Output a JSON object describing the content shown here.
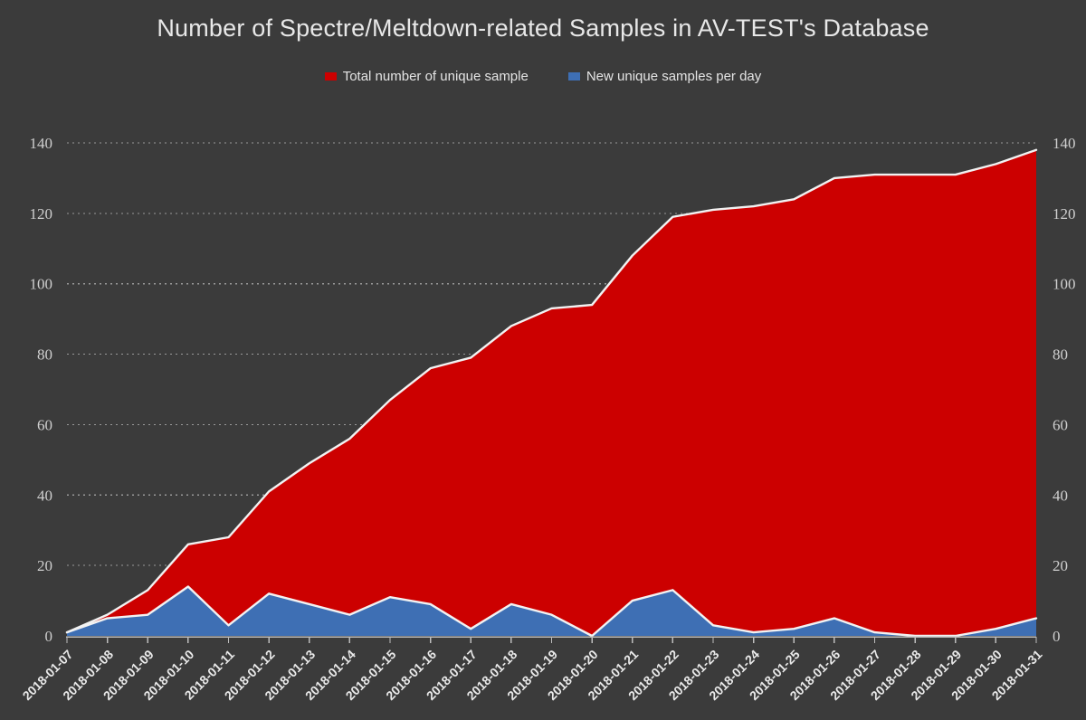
{
  "chart_data": {
    "type": "area",
    "title": "Number of Spectre/Meltdown-related Samples in AV-TEST's Database",
    "xlabel": "",
    "ylabel": "",
    "ylim": [
      0,
      140
    ],
    "yticks": [
      0,
      20,
      40,
      60,
      80,
      100,
      120,
      140
    ],
    "grid": true,
    "legend_position": "top-center",
    "dual_axis": true,
    "background_color": "#3b3b3b",
    "categories": [
      "2018-01-07",
      "2018-01-08",
      "2018-01-09",
      "2018-01-10",
      "2018-01-11",
      "2018-01-12",
      "2018-01-13",
      "2018-01-14",
      "2018-01-15",
      "2018-01-16",
      "2018-01-17",
      "2018-01-18",
      "2018-01-19",
      "2018-01-20",
      "2018-01-21",
      "2018-01-22",
      "2018-01-23",
      "2018-01-24",
      "2018-01-25",
      "2018-01-26",
      "2018-01-27",
      "2018-01-28",
      "2018-01-29",
      "2018-01-30",
      "2018-01-31"
    ],
    "series": [
      {
        "name": "Total number of unique sample",
        "color": "#CC0000",
        "values": [
          1,
          6,
          13,
          26,
          28,
          41,
          49,
          56,
          67,
          76,
          79,
          88,
          93,
          94,
          108,
          119,
          121,
          122,
          124,
          130,
          131,
          131,
          131,
          134,
          138
        ]
      },
      {
        "name": "New unique samples per day",
        "color": "#3E6FB4",
        "values": [
          1,
          5,
          6,
          14,
          3,
          12,
          9,
          6,
          11,
          9,
          2,
          9,
          6,
          0,
          10,
          13,
          3,
          1,
          2,
          5,
          1,
          0,
          0,
          2,
          5
        ]
      }
    ]
  },
  "legend": {
    "items": [
      {
        "label": "Total number of unique sample",
        "color": "#CC0000",
        "name": "legend-total-samples"
      },
      {
        "label": "New unique samples per day",
        "color": "#3E6FB4",
        "name": "legend-new-samples"
      }
    ]
  },
  "axes": {
    "left_tick_labels": [
      "140",
      "120",
      "100",
      "80",
      "60",
      "40",
      "20",
      "0"
    ],
    "right_tick_labels": [
      "140",
      "120",
      "100",
      "80",
      "60",
      "40",
      "20",
      "0"
    ]
  }
}
